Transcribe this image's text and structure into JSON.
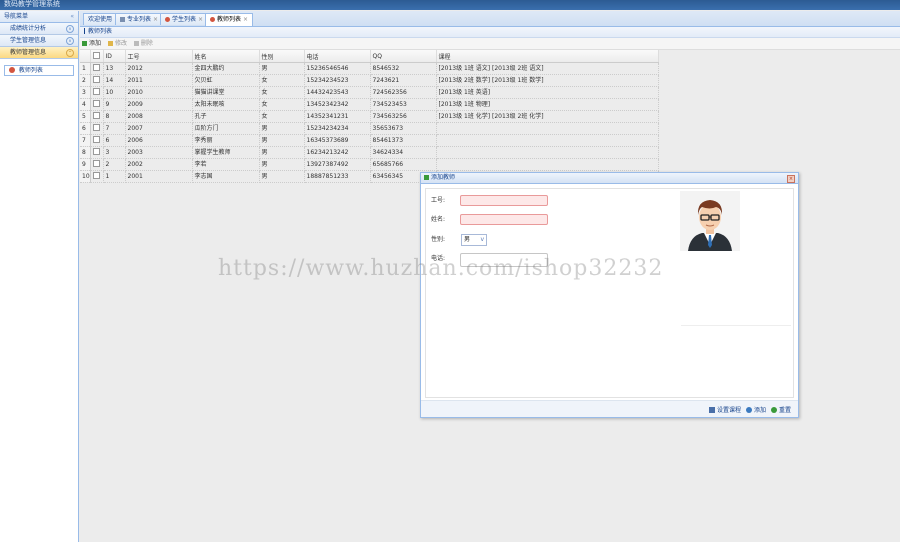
{
  "app": {
    "title": "数码教学管理系统"
  },
  "sidebar": {
    "header": "导航菜单",
    "collapse_glyph": "«",
    "sections": [
      {
        "label": "成绩统计分析",
        "active": false
      },
      {
        "label": "学生管理信息",
        "active": false
      },
      {
        "label": "教师管理信息",
        "active": true
      }
    ],
    "items": [
      {
        "label": "教师列表"
      }
    ]
  },
  "tabs": [
    {
      "label": "欢迎使用",
      "closable": false,
      "active": false
    },
    {
      "label": "专业列表",
      "closable": true,
      "active": false
    },
    {
      "label": "学生列表",
      "closable": true,
      "active": false
    },
    {
      "label": "教师列表",
      "closable": true,
      "active": true
    }
  ],
  "panel": {
    "title": "教师列表"
  },
  "toolbar": {
    "add": "添加",
    "edit": "修改",
    "delete": "删除"
  },
  "grid": {
    "columns": [
      "",
      "",
      "ID",
      "工号",
      "姓名",
      "性别",
      "电话",
      "QQ",
      "课程"
    ],
    "rows": [
      {
        "rn": "1",
        "id": "13",
        "no": "2012",
        "name": "金四大鹏约",
        "sex": "男",
        "phone": "15236546546",
        "qq": "8546532",
        "course": "[2013级 1班 语文]    [2013级 2班 语文]"
      },
      {
        "rn": "2",
        "id": "14",
        "no": "2011",
        "name": "欠贝虹",
        "sex": "女",
        "phone": "15234234523",
        "qq": "7243621",
        "course": "[2013级 2班 数学]    [2013级 1班 数学]"
      },
      {
        "rn": "3",
        "id": "10",
        "no": "2010",
        "name": "猫猫讲课堂",
        "sex": "女",
        "phone": "14432423543",
        "qq": "724562356",
        "course": "[2013级 1班 英语]"
      },
      {
        "rn": "4",
        "id": "9",
        "no": "2009",
        "name": "太阳未眠咳",
        "sex": "女",
        "phone": "13452342342",
        "qq": "734523453",
        "course": "[2013级 1班 物理]"
      },
      {
        "rn": "5",
        "id": "8",
        "no": "2008",
        "name": "孔子",
        "sex": "女",
        "phone": "14352341231",
        "qq": "734563256",
        "course": "[2013级 1班 化学]    [2013级 2班 化学]"
      },
      {
        "rn": "6",
        "id": "7",
        "no": "2007",
        "name": "瓜阶方门",
        "sex": "男",
        "phone": "15234234234",
        "qq": "35653673",
        "course": ""
      },
      {
        "rn": "7",
        "id": "6",
        "no": "2006",
        "name": "李秀丽",
        "sex": "男",
        "phone": "16345373689",
        "qq": "85461373",
        "course": ""
      },
      {
        "rn": "8",
        "id": "3",
        "no": "2003",
        "name": "掌握学生教师",
        "sex": "男",
        "phone": "16234213242",
        "qq": "34624334",
        "course": ""
      },
      {
        "rn": "9",
        "id": "2",
        "no": "2002",
        "name": "李若",
        "sex": "男",
        "phone": "13927387492",
        "qq": "65685766",
        "course": ""
      },
      {
        "rn": "10",
        "id": "1",
        "no": "2001",
        "name": "李志国",
        "sex": "男",
        "phone": "18887851233",
        "qq": "63456345",
        "course": ""
      }
    ]
  },
  "dialog": {
    "title": "添加教师",
    "close_glyph": "×",
    "fields": {
      "no_label": "工号:",
      "no_value": "",
      "name_label": "姓名:",
      "name_value": "",
      "sex_label": "性别:",
      "sex_value": "男",
      "phone_label": "电话:",
      "phone_value": ""
    },
    "footer": {
      "course": "设置课程",
      "add": "添加",
      "reset": "重置"
    }
  },
  "watermark": "https://www.huzhan.com/ishop32232",
  "colors": {
    "accent": "#15428b",
    "header_bar": "#2c5b93",
    "active_section": "#fbd982",
    "required_field": "#fde8e8"
  }
}
